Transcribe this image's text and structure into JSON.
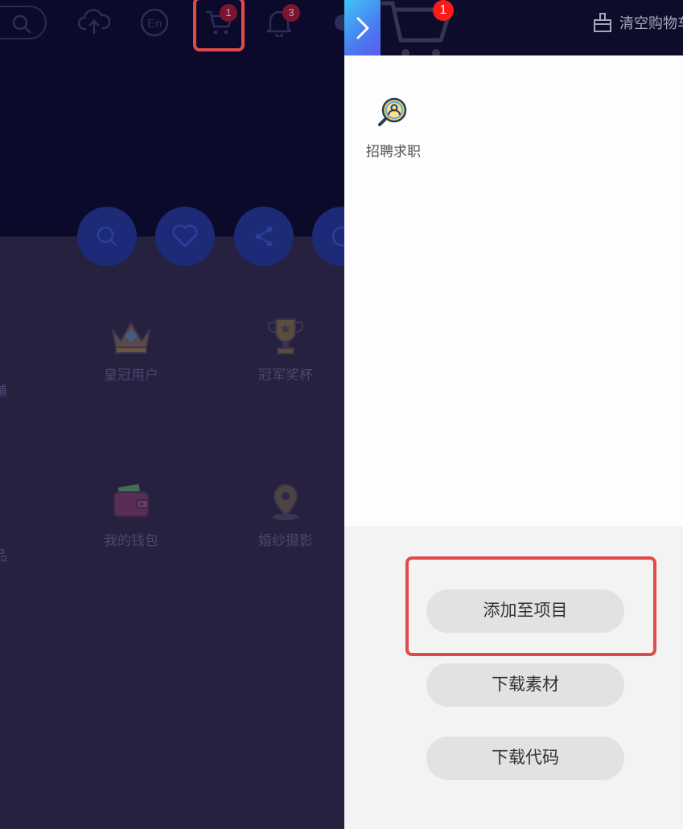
{
  "background_page": {
    "toolbar": {
      "cart_badge": "1",
      "notification_badge": "3",
      "lang_icon_text": "En"
    },
    "grid_labels": {
      "crown_user": "皇冠用户",
      "champion_cup": "冠军奖杯",
      "my_wallet": "我的钱包",
      "wedding_photo": "婚纱摄影",
      "cut_left_row1": "铺",
      "cut_left_row2": "品"
    }
  },
  "cart_panel": {
    "badge_count": "1",
    "clear_cart_label": "清空购物车",
    "items": [
      {
        "label": "招聘求职",
        "icon": "recruitment-search-icon"
      }
    ],
    "actions": {
      "add_to_project": "添加至项目",
      "download_assets": "下载素材",
      "download_code": "下载代码"
    }
  },
  "colors": {
    "highlight": "#e24a4a",
    "badge_red": "#ff1a1a",
    "panel_header": "#0d0d2b"
  }
}
